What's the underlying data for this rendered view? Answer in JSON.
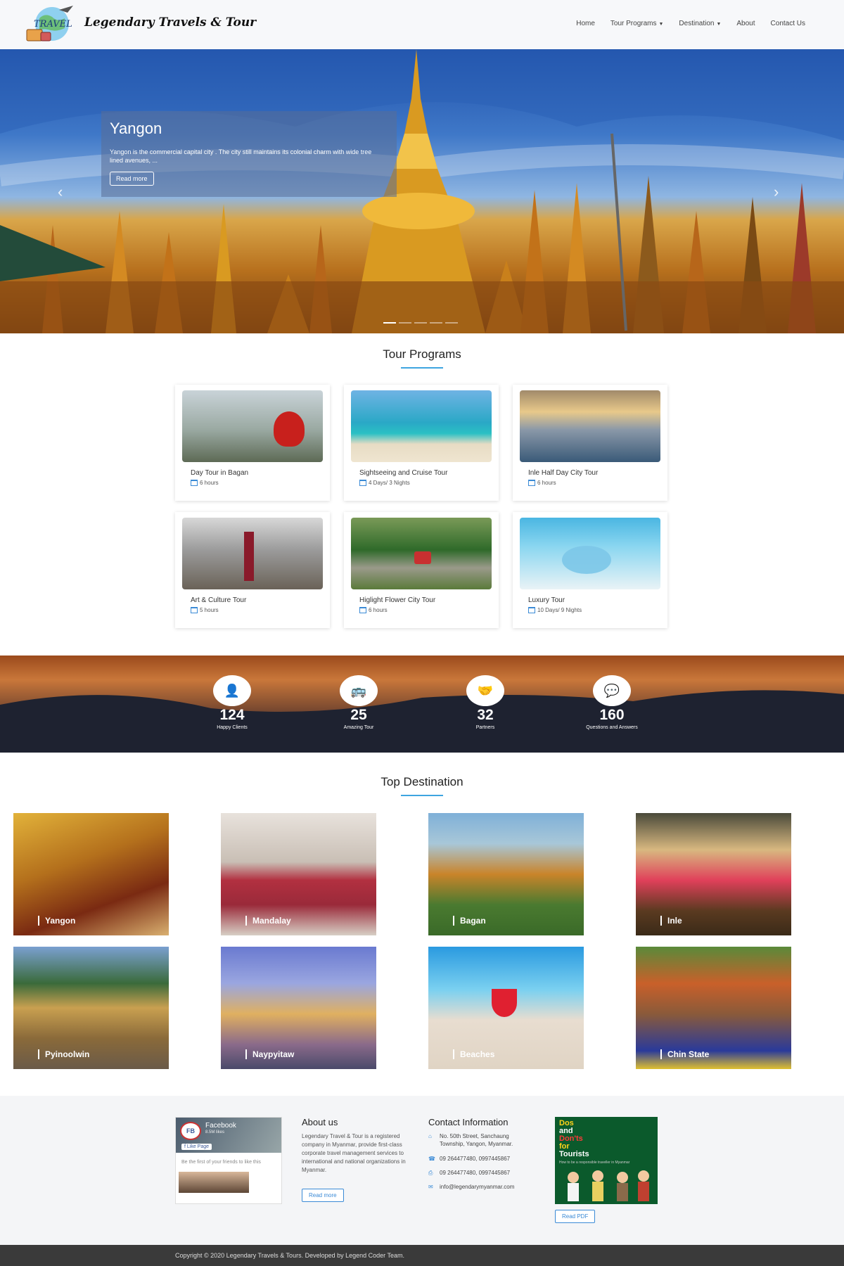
{
  "header": {
    "logo_text": "TRAVEL",
    "brand": "Legendary Travels & Tour",
    "menu": [
      {
        "label": "Home"
      },
      {
        "label": "Tour Programs",
        "dropdown": true
      },
      {
        "label": "Destination",
        "dropdown": true
      },
      {
        "label": "About"
      },
      {
        "label": "Contact Us"
      }
    ]
  },
  "hero": {
    "title": "Yangon",
    "text": "Yangon is the commercial capital city . The city still maintains its colonial charm with wide tree lined avenues, ...",
    "button": "Read more",
    "slides": 5,
    "active_slide": 1
  },
  "tour_programs": {
    "title": "Tour Programs",
    "cards": [
      {
        "title": "Day Tour in Bagan",
        "duration": "6 hours"
      },
      {
        "title": "Sightseeing and Cruise Tour",
        "duration": "4 Days/ 3 Nights"
      },
      {
        "title": "Inle Half Day City Tour",
        "duration": "6 hours"
      },
      {
        "title": "Art & Culture Tour",
        "duration": "5 hours"
      },
      {
        "title": "Higlight Flower City Tour",
        "duration": "6 hours"
      },
      {
        "title": "Luxury Tour",
        "duration": "10 Days/ 9 Nights"
      }
    ]
  },
  "stats": [
    {
      "value": "124",
      "label": "Happy Clients",
      "icon": "person-icon"
    },
    {
      "value": "25",
      "label": "Amazing Tour",
      "icon": "bus-icon"
    },
    {
      "value": "32",
      "label": "Partners",
      "icon": "handshake-icon"
    },
    {
      "value": "160",
      "label": "Questions and Answers",
      "icon": "chat-icon"
    }
  ],
  "top_destination": {
    "title": "Top Destination",
    "items": [
      "Yangon",
      "Mandalay",
      "Bagan",
      "Inle",
      "Pyinoolwin",
      "Naypyitaw",
      "Beaches",
      "Chin State"
    ]
  },
  "footer": {
    "facebook": {
      "logo": "FB",
      "page_name": "Facebook",
      "likes": "8.5M likes",
      "like_button": "Like Page",
      "first_friend": "Be the first of your friends to like this"
    },
    "about": {
      "title": "About us",
      "text": "Legendary Travel & Tour is a registered company in Myanmar, provide first-class corporate travel management services to international and national organizations in Myanmar.",
      "button": "Read more"
    },
    "contact": {
      "title": "Contact Information",
      "address": "No. 50th Street, Sanchaung Township, Yangon, Myanmar.",
      "phone": "09 264477480, 0997445867",
      "fax": "09 264477480, 0997445867",
      "email": "info@legendarymyanmar.com"
    },
    "pdf": {
      "line1": "Dos",
      "line2": "and",
      "line3": "Don'ts",
      "line4": "for",
      "line5": "Tourists",
      "subtitle": "How to be a responsible traveller in Myanmar",
      "button": "Read PDF"
    },
    "copyright": "Copyright © 2020 Legendary Travels & Tours. Developed by Legend Coder Team."
  }
}
